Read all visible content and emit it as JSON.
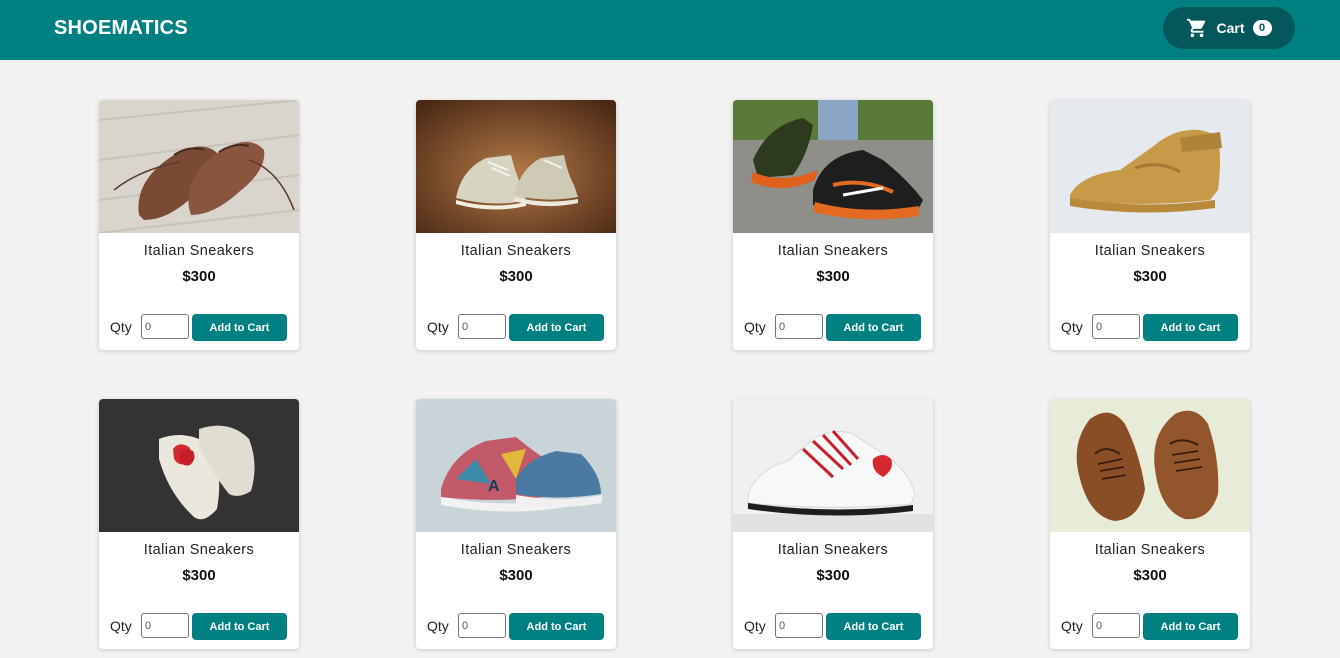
{
  "header": {
    "brand": "SHOEMATICS",
    "cart_label": "Cart",
    "cart_count": "0"
  },
  "colors": {
    "primary": "#008080",
    "cart_button": "#04585c",
    "page_background": "#f2f2f2"
  },
  "products": [
    {
      "title": "Italian Sneakers",
      "price": "$300",
      "qty_label": "Qty",
      "qty_value": "0",
      "button_label": "Add to Cart",
      "image": "brown-oxford-shoes-photo"
    },
    {
      "title": "Italian Sneakers",
      "price": "$300",
      "qty_label": "Qty",
      "qty_value": "0",
      "button_label": "Add to Cart",
      "image": "high-top-canvas-sneakers-photo"
    },
    {
      "title": "Italian Sneakers",
      "price": "$300",
      "qty_label": "Qty",
      "qty_value": "0",
      "button_label": "Add to Cart",
      "image": "orange-running-shoes-photo"
    },
    {
      "title": "Italian Sneakers",
      "price": "$300",
      "qty_label": "Qty",
      "qty_value": "0",
      "button_label": "Add to Cart",
      "image": "tan-high-top-sneaker-photo"
    },
    {
      "title": "Italian Sneakers",
      "price": "$300",
      "qty_label": "Qty",
      "qty_value": "0",
      "button_label": "Add to Cart",
      "image": "white-heart-sneakers-photo"
    },
    {
      "title": "Italian Sneakers",
      "price": "$300",
      "qty_label": "Qty",
      "qty_value": "0",
      "button_label": "Add to Cart",
      "image": "patterned-sneakers-photo"
    },
    {
      "title": "Italian Sneakers",
      "price": "$300",
      "qty_label": "Qty",
      "qty_value": "0",
      "button_label": "Add to Cart",
      "image": "white-red-lace-sneaker-photo"
    },
    {
      "title": "Italian Sneakers",
      "price": "$300",
      "qty_label": "Qty",
      "qty_value": "0",
      "button_label": "Add to Cart",
      "image": "brown-leather-shoes-photo"
    }
  ]
}
